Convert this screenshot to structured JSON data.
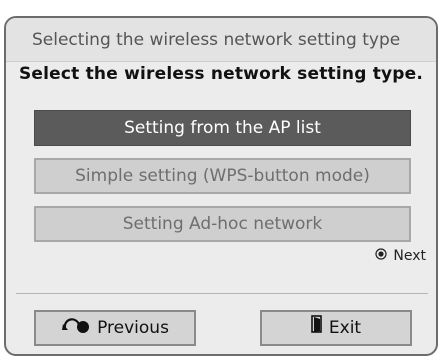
{
  "dialog": {
    "title": "Selecting the wireless network setting type",
    "instruction": "Select the wireless network setting type.",
    "options": [
      {
        "label": "Setting from the AP list",
        "selected": true
      },
      {
        "label": "Simple setting (WPS-button mode)",
        "selected": false
      },
      {
        "label": "Setting Ad-hoc network",
        "selected": false
      }
    ],
    "next_hint": {
      "label": "Next",
      "icon": "ok-button-icon"
    },
    "buttons": {
      "previous": {
        "label": "Previous",
        "icon": "back-arrow-icon"
      },
      "exit": {
        "label": "Exit",
        "icon": "exit-door-icon"
      }
    }
  },
  "colors": {
    "selected_bg": "#5b5b5b",
    "option_bg": "#cfcfcf",
    "dialog_bg": "#ececec"
  }
}
